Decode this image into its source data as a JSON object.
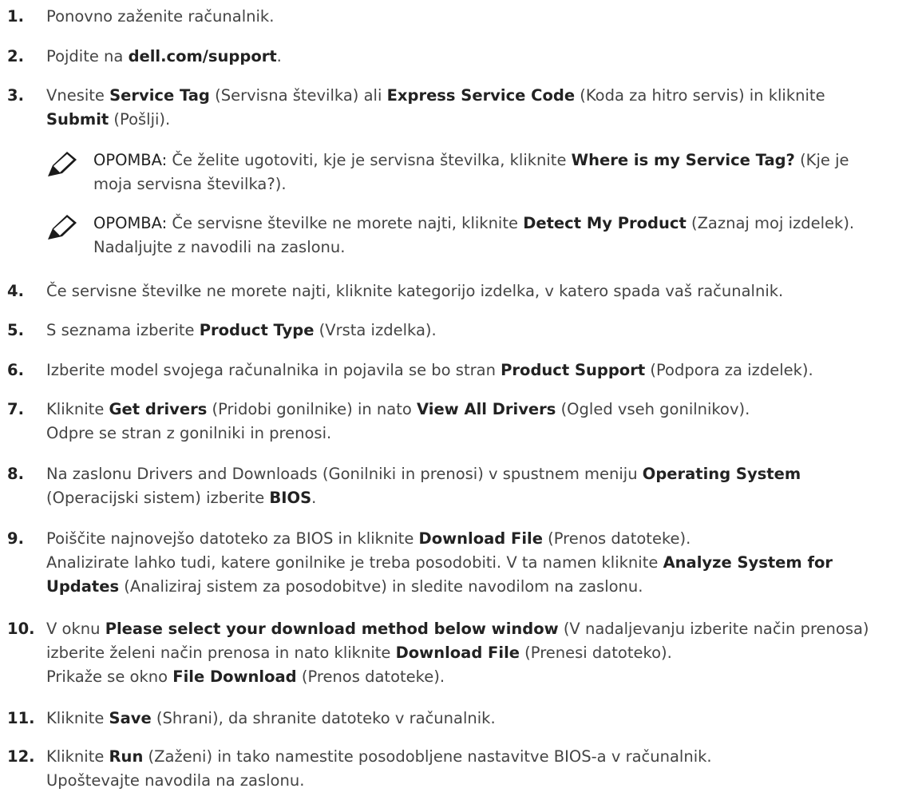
{
  "steps": [
    {
      "num": "1.",
      "lines": [
        [
          {
            "t": "Ponovno zaženite računalnik."
          }
        ]
      ]
    },
    {
      "num": "2.",
      "lines": [
        [
          {
            "t": "Pojdite na "
          },
          {
            "t": "dell.com/support",
            "b": true
          },
          {
            "t": "."
          }
        ]
      ]
    },
    {
      "num": "3.",
      "lines": [
        [
          {
            "t": "Vnesite "
          },
          {
            "t": "Service Tag",
            "b": true
          },
          {
            "t": " (Servisna številka) ali "
          },
          {
            "t": "Express Service Code",
            "b": true
          },
          {
            "t": " (Koda za hitro servis) in kliknite"
          }
        ],
        [
          {
            "t": "Submit",
            "b": true
          },
          {
            "t": " (Pošlji)."
          }
        ]
      ]
    },
    {
      "num": "4.",
      "lines": [
        [
          {
            "t": "Če servisne številke ne morete najti, kliknite kategorijo izdelka, v katero spada vaš računalnik."
          }
        ]
      ]
    },
    {
      "num": "5.",
      "lines": [
        [
          {
            "t": "S seznama izberite "
          },
          {
            "t": "Product Type",
            "b": true
          },
          {
            "t": " (Vrsta izdelka)."
          }
        ]
      ]
    },
    {
      "num": "6.",
      "lines": [
        [
          {
            "t": "Izberite model svojega računalnika in pojavila se bo stran "
          },
          {
            "t": "Product Support",
            "b": true
          },
          {
            "t": " (Podpora za izdelek)."
          }
        ]
      ]
    },
    {
      "num": "7.",
      "lines": [
        [
          {
            "t": "Kliknite "
          },
          {
            "t": "Get drivers",
            "b": true
          },
          {
            "t": " (Pridobi gonilnike) in nato "
          },
          {
            "t": "View All Drivers",
            "b": true
          },
          {
            "t": " (Ogled vseh gonilnikov)."
          }
        ],
        [
          {
            "t": "Odpre se stran z gonilniki in prenosi."
          }
        ]
      ]
    },
    {
      "num": "8.",
      "lines": [
        [
          {
            "t": "Na zaslonu Drivers and Downloads (Gonilniki in prenosi) v spustnem meniju "
          },
          {
            "t": "Operating System",
            "b": true
          }
        ],
        [
          {
            "t": "(Operacijski sistem) izberite "
          },
          {
            "t": "BIOS",
            "b": true
          },
          {
            "t": "."
          }
        ]
      ]
    },
    {
      "num": "9.",
      "lines": [
        [
          {
            "t": "Poiščite najnovejšo datoteko za BIOS in kliknite "
          },
          {
            "t": "Download File",
            "b": true
          },
          {
            "t": " (Prenos datoteke)."
          }
        ],
        [
          {
            "t": "Analizirate lahko tudi, katere gonilnike je treba posodobiti. V ta namen kliknite "
          },
          {
            "t": "Analyze System for",
            "b": true
          }
        ],
        [
          {
            "t": "Updates",
            "b": true
          },
          {
            "t": " (Analiziraj sistem za posodobitve) in sledite navodilom na zaslonu."
          }
        ]
      ]
    },
    {
      "num": "10.",
      "lines": [
        [
          {
            "t": "V oknu "
          },
          {
            "t": "Please select your download method below window",
            "b": true
          },
          {
            "t": " (V nadaljevanju izberite način prenosa)"
          }
        ],
        [
          {
            "t": "izberite želeni način prenosa in nato kliknite "
          },
          {
            "t": "Download File",
            "b": true
          },
          {
            "t": " (Prenesi datoteko)."
          }
        ],
        [
          {
            "t": "Prikaže se okno "
          },
          {
            "t": "File Download",
            "b": true
          },
          {
            "t": " (Prenos datoteke)."
          }
        ]
      ]
    },
    {
      "num": "11.",
      "lines": [
        [
          {
            "t": "Kliknite "
          },
          {
            "t": "Save",
            "b": true
          },
          {
            "t": " (Shrani), da shranite datoteko v računalnik."
          }
        ]
      ]
    },
    {
      "num": "12.",
      "lines": [
        [
          {
            "t": "Kliknite "
          },
          {
            "t": "Run",
            "b": true
          },
          {
            "t": " (Zaženi) in tako namestite posodobljene nastavitve BIOS-a v računalnik."
          }
        ],
        [
          {
            "t": "Upoštevajte navodila na zaslonu."
          }
        ]
      ]
    }
  ],
  "notes": [
    {
      "icon": "note-pencil-icon",
      "label": "OPOMBA:",
      "lines": [
        [
          {
            "t": " Če želite ugotoviti, kje je servisna številka, kliknite "
          },
          {
            "t": "Where is my Service Tag?",
            "b": true
          },
          {
            "t": " (Kje je"
          }
        ],
        [
          {
            "t": "moja servisna številka?)."
          }
        ]
      ]
    },
    {
      "icon": "note-pencil-icon",
      "label": "OPOMBA:",
      "lines": [
        [
          {
            "t": " Če servisne številke ne morete najti, kliknite "
          },
          {
            "t": "Detect My Product",
            "b": true
          },
          {
            "t": " (Zaznaj moj izdelek)."
          }
        ],
        [
          {
            "t": "Nadaljujte z navodili na zaslonu."
          }
        ]
      ]
    }
  ]
}
